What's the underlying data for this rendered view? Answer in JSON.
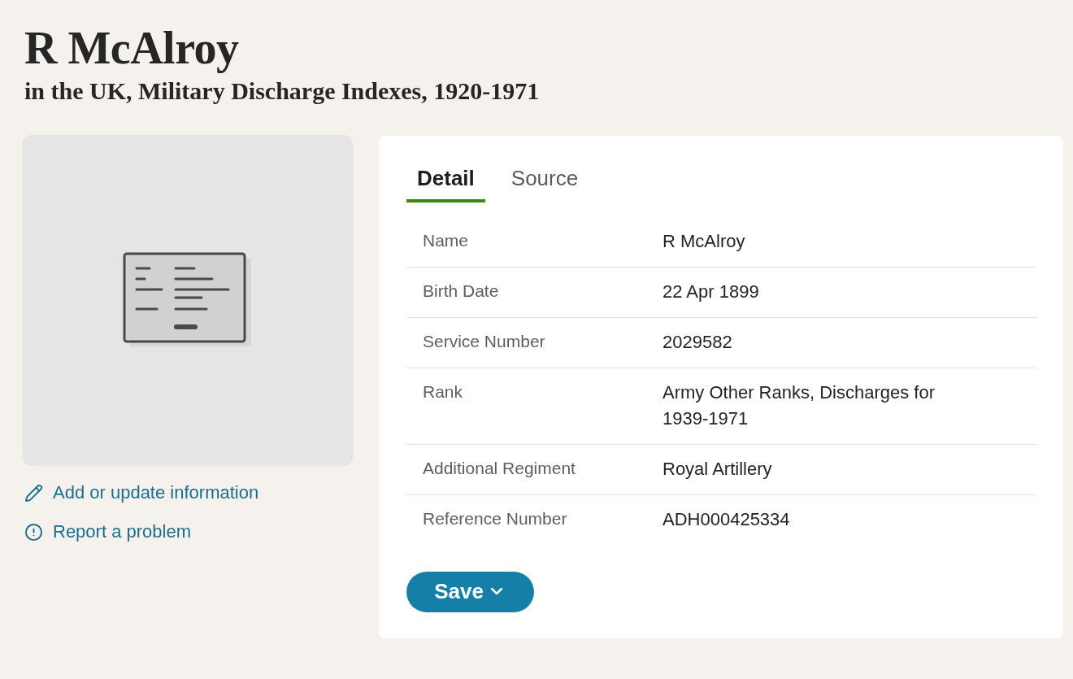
{
  "header": {
    "title": "R McAlroy",
    "subtitle": "in the UK, Military Discharge Indexes, 1920-1971"
  },
  "actions": [
    {
      "kind": "edit",
      "label": "Add or update information"
    },
    {
      "kind": "report",
      "label": "Report a problem"
    }
  ],
  "tabs": [
    {
      "label": "Detail",
      "selected": true
    },
    {
      "label": "Source",
      "selected": false
    }
  ],
  "details": [
    {
      "label": "Name",
      "value": "R McAlroy"
    },
    {
      "label": "Birth Date",
      "value": "22 Apr 1899"
    },
    {
      "label": "Service Number",
      "value": "2029582"
    },
    {
      "label": "Rank",
      "value": "Army Other Ranks, Discharges for 1939-1971"
    },
    {
      "label": "Additional Regiment",
      "value": "Royal Artillery"
    },
    {
      "label": "Reference Number",
      "value": "ADH000425334"
    }
  ],
  "save_button": {
    "label": "Save"
  }
}
